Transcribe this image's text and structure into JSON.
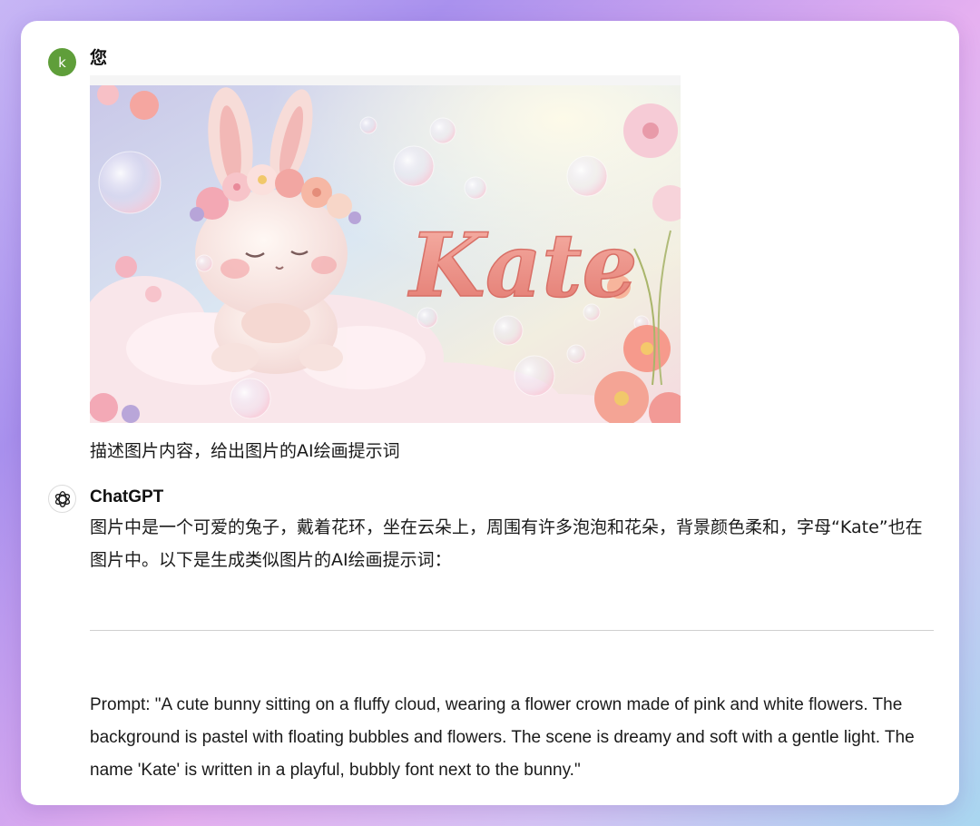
{
  "colors": {
    "user_avatar_bg": "#5f9e3a",
    "card_bg": "#ffffff",
    "divider": "#cfcfcf",
    "kate_text": "#f09a8e"
  },
  "user": {
    "avatar_letter": "k",
    "name": "您",
    "image_icon": "bunny-on-cloud-image",
    "image_text": "Kate",
    "question": "描述图片内容，给出图片的AI绘画提示词"
  },
  "assistant": {
    "avatar_icon": "openai-logo-icon",
    "name": "ChatGPT",
    "answer": "图片中是一个可爱的兔子，戴着花环，坐在云朵上，周围有许多泡泡和花朵，背景颜色柔和，字母“Kate”也在图片中。以下是生成类似图片的AI绘画提示词：",
    "prompt": "Prompt: \"A cute bunny sitting on a fluffy cloud, wearing a flower crown made of pink and white flowers. The background is pastel with floating bubbles and flowers. The scene is dreamy and soft with a gentle light. The name 'Kate' is written in a playful, bubbly font next to the bunny.\""
  }
}
